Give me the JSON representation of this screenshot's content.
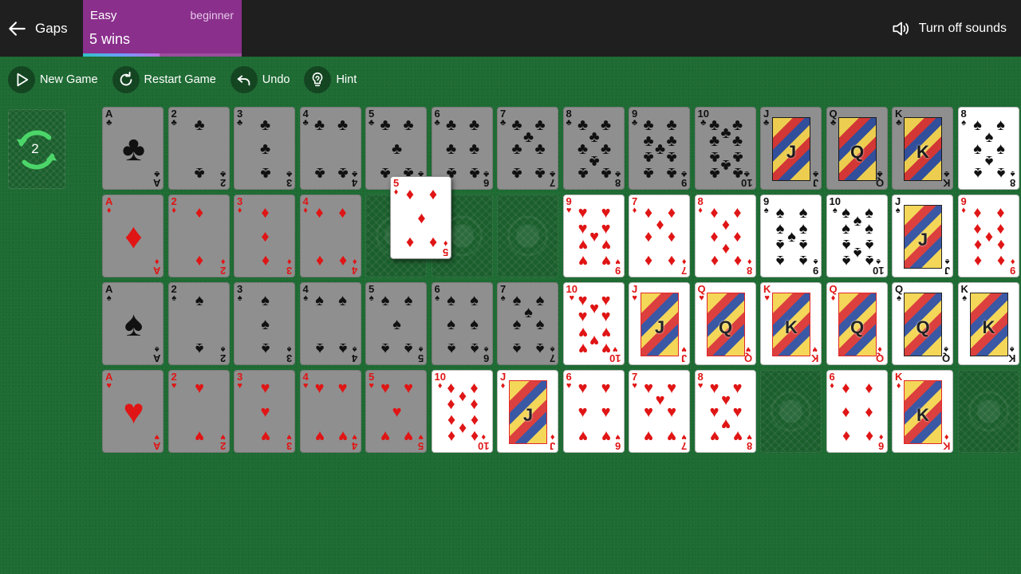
{
  "header": {
    "back_label": "Gaps",
    "difficulty_level": "Easy",
    "difficulty_tag": "beginner",
    "wins_text": "5 wins",
    "progress_fraction": 0.48,
    "sound_label": "Turn off sounds"
  },
  "toolbar": {
    "new_game": "New Game",
    "restart_game": "Restart Game",
    "undo": "Undo",
    "hint": "Hint"
  },
  "redeal": {
    "count": "2"
  },
  "colors": {
    "felt": "#1e6b33",
    "topbar": "#1f1f1f",
    "difficulty": "#8a2f8c",
    "red_suit": "#e01515"
  },
  "board": {
    "rows": [
      [
        {
          "rank": "A",
          "suit": "♣",
          "color": "black",
          "dim": true
        },
        {
          "rank": "2",
          "suit": "♣",
          "color": "black",
          "dim": true
        },
        {
          "rank": "3",
          "suit": "♣",
          "color": "black",
          "dim": true
        },
        {
          "rank": "4",
          "suit": "♣",
          "color": "black",
          "dim": true
        },
        {
          "rank": "5",
          "suit": "♣",
          "color": "black",
          "dim": true
        },
        {
          "rank": "6",
          "suit": "♣",
          "color": "black",
          "dim": true
        },
        {
          "rank": "7",
          "suit": "♣",
          "color": "black",
          "dim": true
        },
        {
          "rank": "8",
          "suit": "♣",
          "color": "black",
          "dim": true
        },
        {
          "rank": "9",
          "suit": "♣",
          "color": "black",
          "dim": true
        },
        {
          "rank": "10",
          "suit": "♣",
          "color": "black",
          "dim": true
        },
        {
          "rank": "J",
          "suit": "♣",
          "color": "black",
          "dim": true
        },
        {
          "rank": "Q",
          "suit": "♣",
          "color": "black",
          "dim": true
        },
        {
          "rank": "K",
          "suit": "♣",
          "color": "black",
          "dim": true
        },
        {
          "rank": "8",
          "suit": "♠",
          "color": "black",
          "dim": false
        }
      ],
      [
        {
          "rank": "A",
          "suit": "♦",
          "color": "red",
          "dim": true
        },
        {
          "rank": "2",
          "suit": "♦",
          "color": "red",
          "dim": true
        },
        {
          "rank": "3",
          "suit": "♦",
          "color": "red",
          "dim": true
        },
        {
          "rank": "4",
          "suit": "♦",
          "color": "red",
          "dim": true
        },
        null,
        null,
        null,
        {
          "rank": "9",
          "suit": "♥",
          "color": "red",
          "dim": false
        },
        {
          "rank": "7",
          "suit": "♦",
          "color": "red",
          "dim": false
        },
        {
          "rank": "8",
          "suit": "♦",
          "color": "red",
          "dim": false
        },
        {
          "rank": "9",
          "suit": "♠",
          "color": "black",
          "dim": false
        },
        {
          "rank": "10",
          "suit": "♠",
          "color": "black",
          "dim": false
        },
        {
          "rank": "J",
          "suit": "♠",
          "color": "black",
          "dim": false
        },
        {
          "rank": "9",
          "suit": "♦",
          "color": "red",
          "dim": false
        }
      ],
      [
        {
          "rank": "A",
          "suit": "♠",
          "color": "black",
          "dim": true
        },
        {
          "rank": "2",
          "suit": "♠",
          "color": "black",
          "dim": true
        },
        {
          "rank": "3",
          "suit": "♠",
          "color": "black",
          "dim": true
        },
        {
          "rank": "4",
          "suit": "♠",
          "color": "black",
          "dim": true
        },
        {
          "rank": "5",
          "suit": "♠",
          "color": "black",
          "dim": true
        },
        {
          "rank": "6",
          "suit": "♠",
          "color": "black",
          "dim": true
        },
        {
          "rank": "7",
          "suit": "♠",
          "color": "black",
          "dim": true
        },
        {
          "rank": "10",
          "suit": "♥",
          "color": "red",
          "dim": false
        },
        {
          "rank": "J",
          "suit": "♥",
          "color": "red",
          "dim": false
        },
        {
          "rank": "Q",
          "suit": "♥",
          "color": "red",
          "dim": false
        },
        {
          "rank": "K",
          "suit": "♥",
          "color": "red",
          "dim": false
        },
        {
          "rank": "Q",
          "suit": "♦",
          "color": "red",
          "dim": false
        },
        {
          "rank": "Q",
          "suit": "♠",
          "color": "black",
          "dim": false
        },
        {
          "rank": "K",
          "suit": "♠",
          "color": "black",
          "dim": false
        }
      ],
      [
        {
          "rank": "A",
          "suit": "♥",
          "color": "red",
          "dim": true
        },
        {
          "rank": "2",
          "suit": "♥",
          "color": "red",
          "dim": true
        },
        {
          "rank": "3",
          "suit": "♥",
          "color": "red",
          "dim": true
        },
        {
          "rank": "4",
          "suit": "♥",
          "color": "red",
          "dim": true
        },
        {
          "rank": "5",
          "suit": "♥",
          "color": "red",
          "dim": true
        },
        {
          "rank": "10",
          "suit": "♦",
          "color": "red",
          "dim": false
        },
        {
          "rank": "J",
          "suit": "♦",
          "color": "red",
          "dim": false
        },
        {
          "rank": "6",
          "suit": "♥",
          "color": "red",
          "dim": false
        },
        {
          "rank": "7",
          "suit": "♥",
          "color": "red",
          "dim": false
        },
        {
          "rank": "8",
          "suit": "♥",
          "color": "red",
          "dim": false
        },
        null,
        {
          "rank": "6",
          "suit": "♦",
          "color": "red",
          "dim": false
        },
        {
          "rank": "K",
          "suit": "♦",
          "color": "red",
          "dim": false
        },
        null
      ]
    ],
    "held_card": {
      "rank": "5",
      "suit": "♦",
      "color": "red"
    }
  }
}
